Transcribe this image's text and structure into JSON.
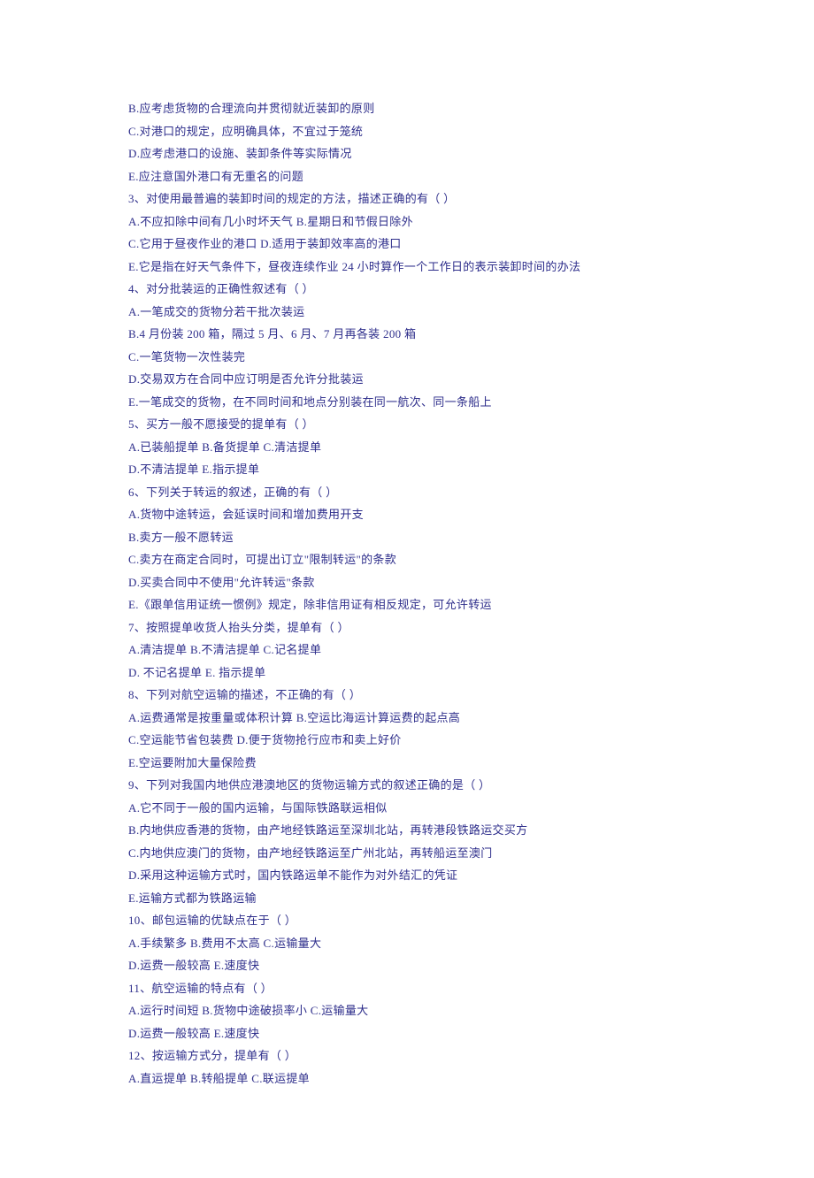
{
  "lines": [
    "B.应考虑货物的合理流向并贯彻就近装卸的原则",
    "C.对港口的规定，应明确具体，不宜过于笼统",
    "D.应考虑港口的设施、装卸条件等实际情况",
    "E.应注意国外港口有无重名的问题",
    "3、对使用最普遍的装卸时间的规定的方法，描述正确的有（  ）",
    "A.不应扣除中间有几小时坏天气  B.星期日和节假日除外",
    "C.它用于昼夜作业的港口  D.适用于装卸效率高的港口",
    "E.它是指在好天气条件下，昼夜连续作业 24 小时算作一个工作日的表示装卸时间的办法",
    "4、对分批装运的正确性叙述有（  ）",
    "A.一笔成交的货物分若干批次装运",
    "B.4 月份装 200 箱，隔过 5 月、6 月、7 月再各装 200 箱",
    "C.一笔货物一次性装完",
    "D.交易双方在合同中应订明是否允许分批装运",
    "E.一笔成交的货物，在不同时间和地点分别装在同一航次、同一条船上",
    "5、买方一般不愿接受的提单有（  ）",
    "A.已装船提单  B.备货提单  C.清洁提单",
    "D.不清洁提单  E.指示提单",
    "6、下列关于转运的叙述，正确的有（  ）",
    "A.货物中途转运，会延误时间和增加费用开支",
    "B.卖方一般不愿转运",
    "C.卖方在商定合同时，可提出订立\"限制转运\"的条款",
    "D.买卖合同中不使用\"允许转运\"条款",
    "E.《跟单信用证统一惯例》规定，除非信用证有相反规定，可允许转运",
    "7、按照提单收货人抬头分类，提单有（  ）",
    "A.清洁提单  B.不清洁提单  C.记名提单",
    "D. 不记名提单  E. 指示提单",
    "8、下列对航空运输的描述，不正确的有（  ）",
    "A.运费通常是按重量或体积计算  B.空运比海运计算运费的起点高",
    "C.空运能节省包装费  D.便于货物抢行应市和卖上好价",
    "E.空运要附加大量保险费",
    "9、下列对我国内地供应港澳地区的货物运输方式的叙述正确的是（  ）",
    "A.它不同于一般的国内运输，与国际铁路联运相似",
    "B.内地供应香港的货物，由产地经铁路运至深圳北站，再转港段铁路运交买方",
    "C.内地供应澳门的货物，由产地经铁路运至广州北站，再转船运至澳门",
    "D.采用这种运输方式时，国内铁路运单不能作为对外结汇的凭证",
    "E.运输方式都为铁路运输",
    "10、邮包运输的优缺点在于（  ）",
    "A.手续繁多  B.费用不太高  C.运输量大",
    "D.运费一般较高  E.速度快",
    "11、航空运输的特点有（  ）",
    "A.运行时间短  B.货物中途破损率小  C.运输量大",
    "D.运费一般较高  E.速度快",
    "12、按运输方式分，提单有（  ）",
    "A.直运提单  B.转船提单  C.联运提单"
  ]
}
